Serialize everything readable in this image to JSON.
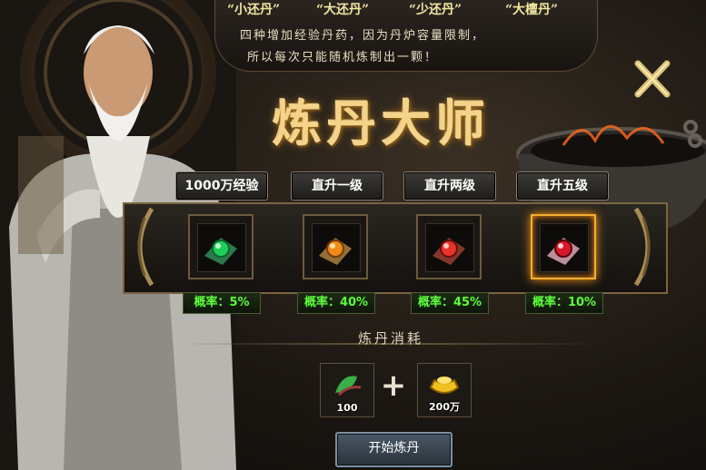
{
  "banner": {
    "pills": [
      "“小还丹”",
      "“大还丹”",
      "“少还丹”",
      "“大檀丹”"
    ],
    "line1": "四种增加经验丹药，因为丹炉容量限制，",
    "line2": "所以每次只能随机炼制出一颗！"
  },
  "title": "炼丹大师",
  "options": [
    {
      "label": "1000万经验",
      "rate": "概率：5%",
      "gem": "green"
    },
    {
      "label": "直升一级",
      "rate": "概率：40%",
      "gem": "orange"
    },
    {
      "label": "直升两级",
      "rate": "概率：45%",
      "gem": "red"
    },
    {
      "label": "直升五级",
      "rate": "概率：10%",
      "gem": "crimson"
    }
  ],
  "cost": {
    "title": "炼丹消耗",
    "items": [
      {
        "count": "100",
        "icon": "herb-icon"
      },
      {
        "count": "200万",
        "icon": "gold-ingot-icon"
      }
    ]
  },
  "start_button": "开始炼丹",
  "colors": {
    "accent_gold": "#f3d48a",
    "rate_green": "#5cff3a",
    "selected_glow": "#ff9d1a"
  }
}
